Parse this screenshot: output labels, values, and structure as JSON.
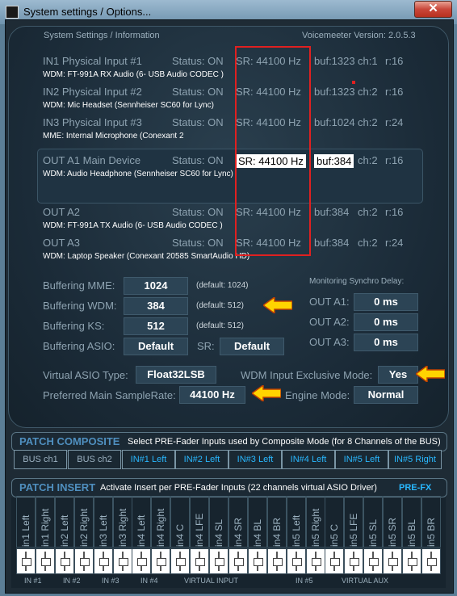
{
  "window": {
    "title": "System settings / Options...",
    "close_glyph": "✕"
  },
  "header": {
    "left": "System Settings / Information",
    "right": "Voicemeeter Version: 2.0.5.3"
  },
  "devices": [
    {
      "name": "IN1 Physical Input #1",
      "status": "Status: ON",
      "sr": "SR: 44100 Hz",
      "buf": "buf:1323",
      "ch": "ch:1",
      "r": "r:16",
      "driver": "WDM: FT-991A RX Audio (6- USB Audio CODEC )"
    },
    {
      "name": "IN2 Physical Input #2",
      "status": "Status: ON",
      "sr": "SR: 44100 Hz",
      "buf": "buf:1323",
      "ch": "ch:2",
      "r": "r:16",
      "driver": "WDM: Mic Headset (Sennheiser SC60 for Lync)"
    },
    {
      "name": "IN3 Physical Input #3",
      "status": "Status: ON",
      "sr": "SR: 44100 Hz",
      "buf": "buf:1024",
      "ch": "ch:2",
      "r": "r:24",
      "driver": "MME: Internal Microphone (Conexant 2"
    },
    {
      "name": "OUT A1 Main Device",
      "status": "Status: ON",
      "sr": "SR: 44100 Hz",
      "buf": "buf:384",
      "ch": "ch:2",
      "r": "r:16",
      "driver": "WDM: Audio Headphone (Sennheiser SC60 for Lync)"
    },
    {
      "name": "OUT A2",
      "status": "Status: ON",
      "sr": "SR: 44100 Hz",
      "buf": "buf:384",
      "ch": "ch:2",
      "r": "r:16",
      "driver": "WDM: FT-991A TX Audio (6- USB Audio CODEC )"
    },
    {
      "name": "OUT A3",
      "status": "Status: ON",
      "sr": "SR: 44100 Hz",
      "buf": "buf:384",
      "ch": "ch:2",
      "r": "r:24",
      "driver": "WDM: Laptop Speaker (Conexant 20585 SmartAudio HD)"
    }
  ],
  "buffering": {
    "mme": {
      "label": "Buffering MME:",
      "value": "1024",
      "default": "(default: 1024)"
    },
    "wdm": {
      "label": "Buffering WDM:",
      "value": "384",
      "default": "(default: 512)"
    },
    "ks": {
      "label": "Buffering KS:",
      "value": "512",
      "default": "(default: 512)"
    },
    "asio": {
      "label": "Buffering ASIO:",
      "value": "Default",
      "sr_label": "SR:",
      "sr_value": "Default"
    }
  },
  "monitoring": {
    "title": "Monitoring Synchro Delay:",
    "rows": [
      {
        "label": "OUT A1:",
        "value": "0 ms"
      },
      {
        "label": "OUT A2:",
        "value": "0 ms"
      },
      {
        "label": "OUT A3:",
        "value": "0 ms"
      }
    ]
  },
  "misc": {
    "asio_type_label": "Virtual ASIO Type:",
    "asio_type_value": "Float32LSB",
    "wdm_excl_label": "WDM Input Exclusive Mode:",
    "wdm_excl_value": "Yes",
    "samplerate_label": "Preferred Main SampleRate:",
    "samplerate_value": "44100 Hz",
    "engine_label": "Engine Mode:",
    "engine_value": "Normal"
  },
  "patch_composite": {
    "title": "PATCH COMPOSITE",
    "desc": "Select PRE-Fader Inputs used by Composite Mode (for 8 Channels of the BUS)",
    "buttons": [
      "BUS ch1",
      "BUS ch2",
      "IN#1 Left",
      "IN#2 Left",
      "IN#3 Left",
      "IN#4 Left",
      "IN#5 Left",
      "IN#5 Right"
    ],
    "active": [
      false,
      false,
      true,
      true,
      true,
      true,
      true,
      true
    ]
  },
  "patch_insert": {
    "title": "PATCH INSERT",
    "desc": "Activate Insert per PRE-Fader Inputs (22 channels virtual ASIO Driver)",
    "prefx": "PRE-FX",
    "channels": [
      "in1 Left",
      "in1 Right",
      "in2 Left",
      "in2 Right",
      "in3 Left",
      "in3 Right",
      "in4 Left",
      "in4 Right",
      "in4 C",
      "in4 LFE",
      "in4 SL",
      "in4 SR",
      "in4 BL",
      "in4 BR",
      "in5 Left",
      "in5 Right",
      "in5 C",
      "in5 LFE",
      "in5 SL",
      "in5 SR",
      "in5 BL",
      "in5 BR"
    ],
    "groups": [
      "IN #1",
      "IN #2",
      "IN #3",
      "IN #4",
      "VIRTUAL INPUT",
      "IN #5",
      "VIRTUAL AUX"
    ]
  },
  "colors": {
    "accent": "#29b8ff",
    "highlight_red": "#e02020",
    "arrow_yellow": "#ffd400"
  }
}
